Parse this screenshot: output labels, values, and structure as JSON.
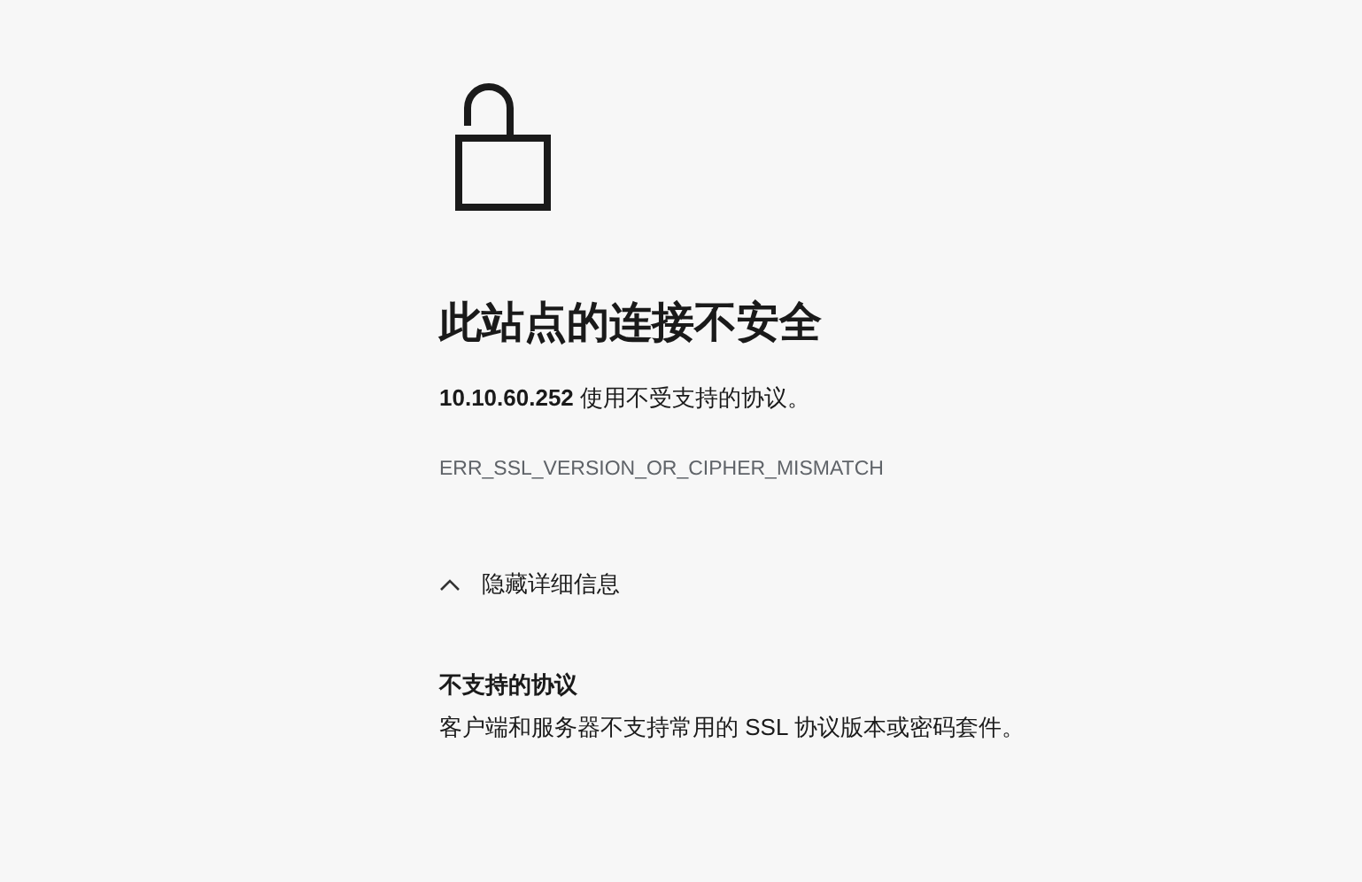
{
  "title": "此站点的连接不安全",
  "message": "**10.10.60.252** 使用不受支持的协议。",
  "error_code": "ERR_SSL_VERSION_OR_CIPHER_MISMATCH",
  "details_toggle": {
    "label": "隐藏详细信息",
    "expanded": true
  },
  "details": {
    "heading": "不支持的协议",
    "text": "客户端和服务器不支持常用的 SSL 协议版本或密码套件。"
  }
}
